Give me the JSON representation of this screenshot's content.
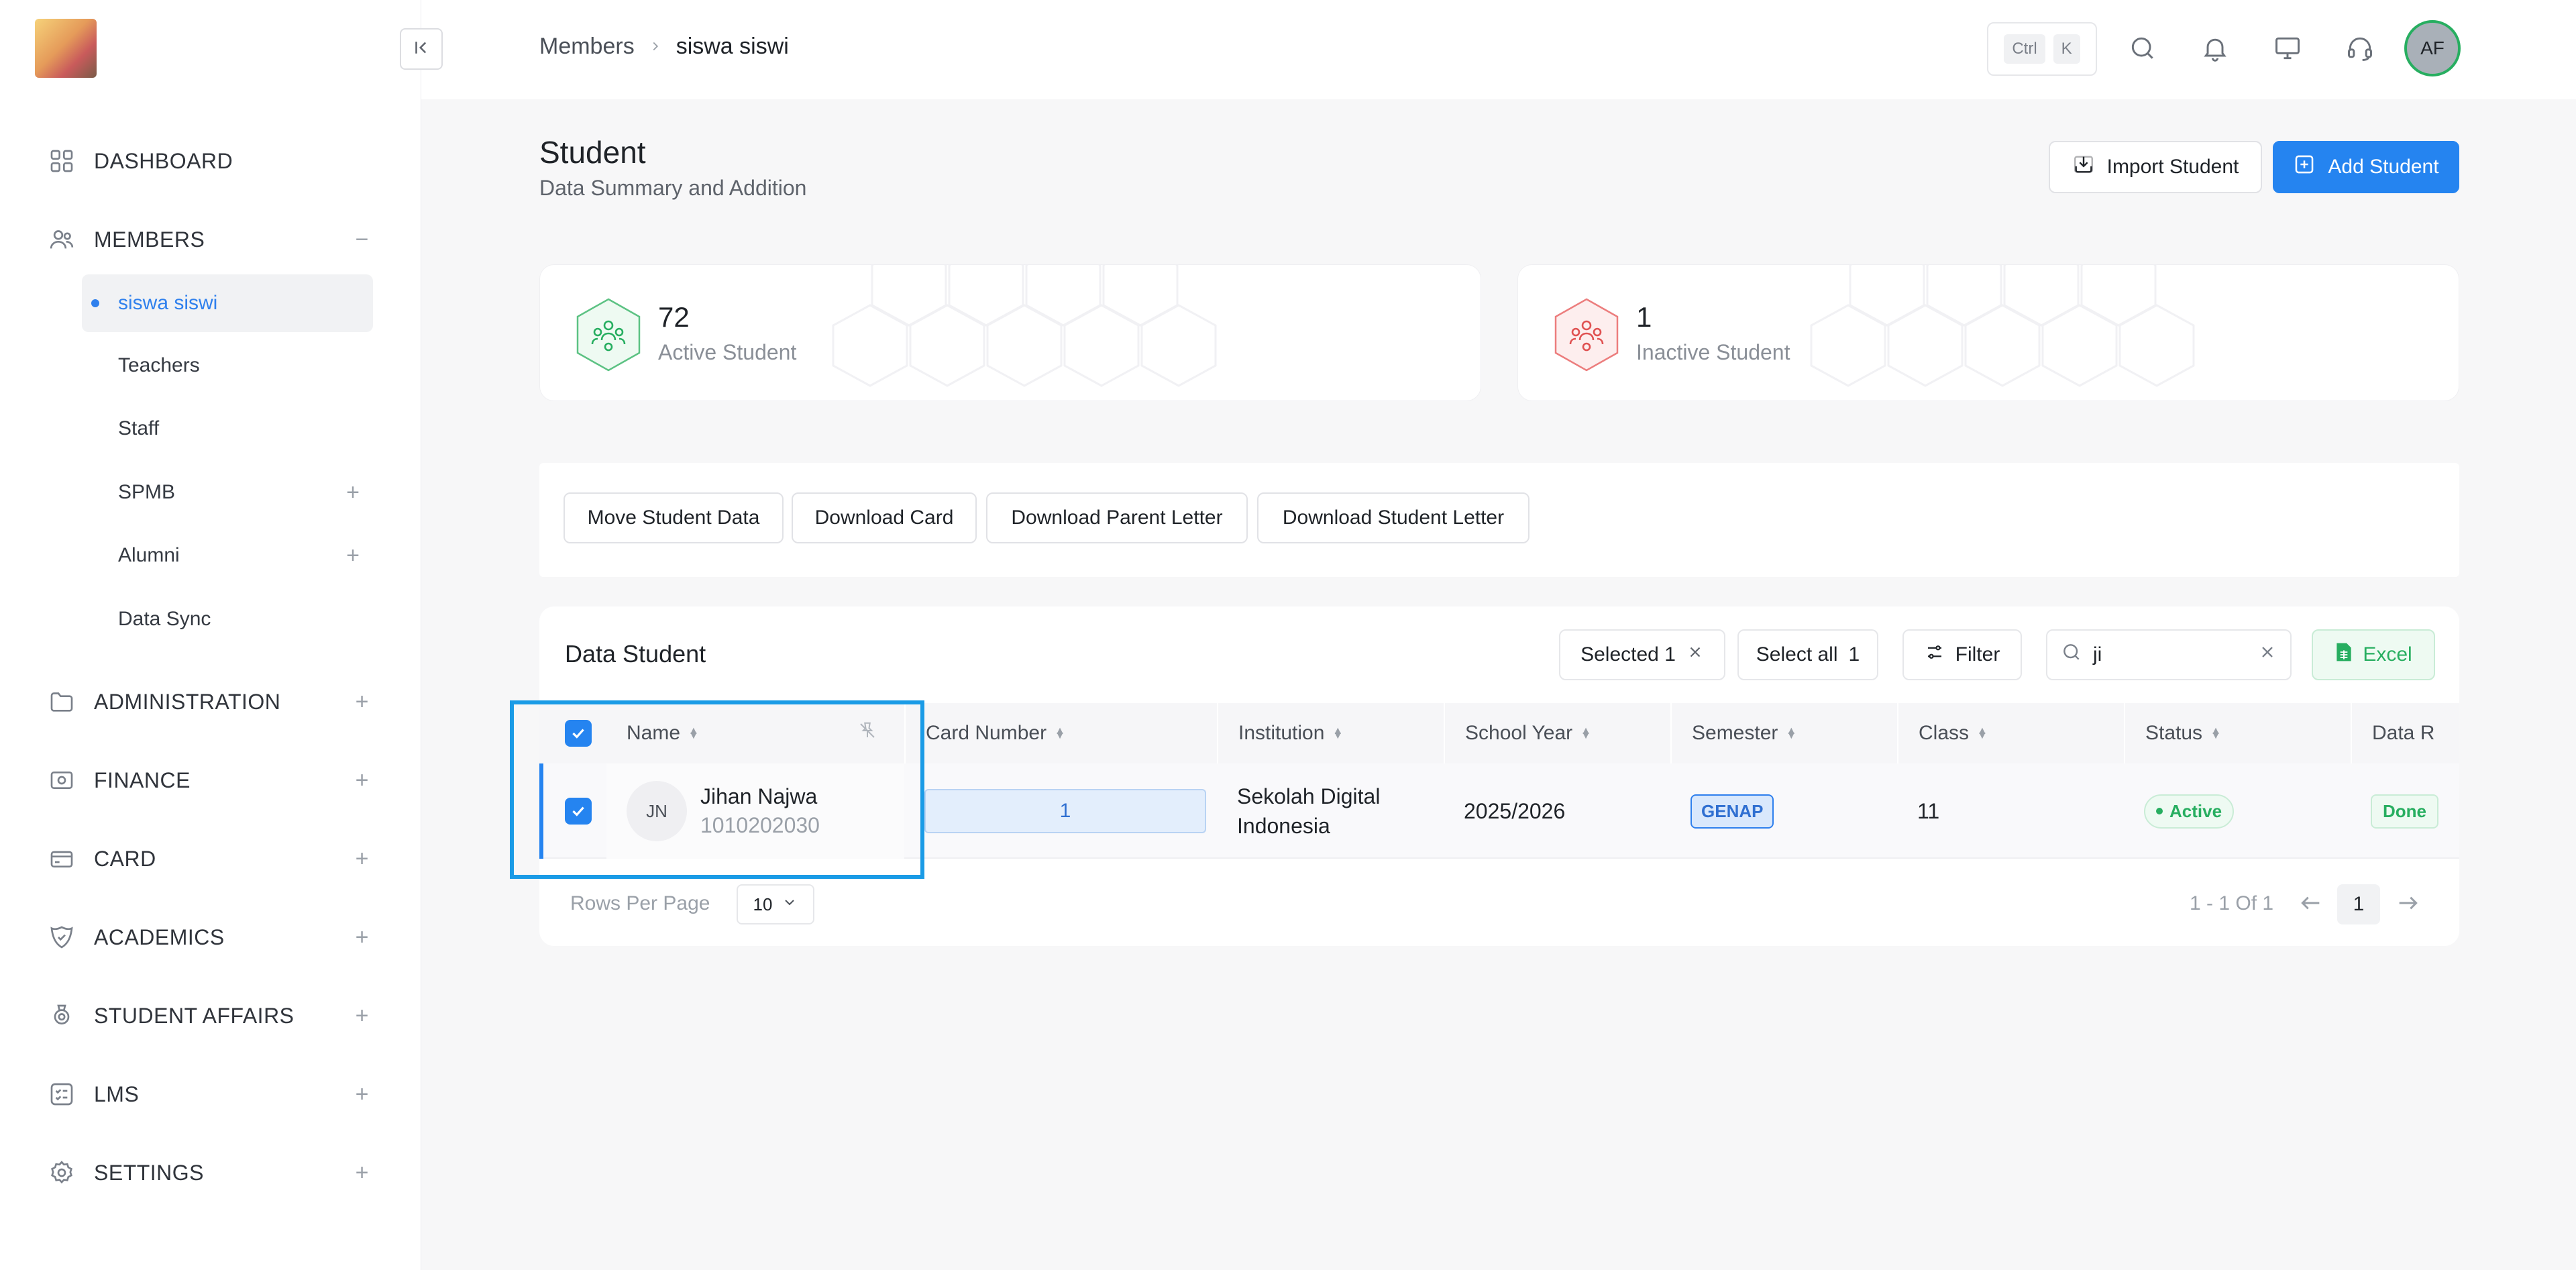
{
  "sidebar": {
    "items": [
      {
        "label": "DASHBOARD",
        "icon": "grid-icon",
        "sign": ""
      },
      {
        "label": "MEMBERS",
        "icon": "users-icon",
        "sign": "−"
      },
      {
        "label": "ADMINISTRATION",
        "icon": "folder-icon",
        "sign": "+"
      },
      {
        "label": "FINANCE",
        "icon": "money-icon",
        "sign": "+"
      },
      {
        "label": "CARD",
        "icon": "card-icon",
        "sign": "+"
      },
      {
        "label": "ACADEMICS",
        "icon": "academics-icon",
        "sign": "+"
      },
      {
        "label": "STUDENT AFFAIRS",
        "icon": "award-icon",
        "sign": "+"
      },
      {
        "label": "LMS",
        "icon": "checklist-icon",
        "sign": "+"
      },
      {
        "label": "SETTINGS",
        "icon": "gear-icon",
        "sign": "+"
      }
    ],
    "members_sub": [
      {
        "label": "siswa siswi",
        "sign": ""
      },
      {
        "label": "Teachers",
        "sign": ""
      },
      {
        "label": "Staff",
        "sign": ""
      },
      {
        "label": "SPMB",
        "sign": "+"
      },
      {
        "label": "Alumni",
        "sign": "+"
      },
      {
        "label": "Data Sync",
        "sign": ""
      }
    ]
  },
  "header": {
    "breadcrumb": [
      "Members",
      "siswa siswi"
    ],
    "shortcut": [
      "Ctrl",
      "K"
    ],
    "avatar_initials": "AF"
  },
  "page": {
    "title": "Student",
    "subtitle": "Data Summary and Addition",
    "import_label": "Import Student",
    "add_label": "Add Student"
  },
  "stats": {
    "active": {
      "value": "72",
      "label": "Active Student"
    },
    "inactive": {
      "value": "1",
      "label": "Inactive Student"
    }
  },
  "actions": [
    "Move Student Data",
    "Download Card",
    "Download Parent Letter",
    "Download Student Letter"
  ],
  "table": {
    "title": "Data Student",
    "selected_label": "Selected 1",
    "select_all_label": "Select all",
    "select_all_count": "1",
    "filter_label": "Filter",
    "search_value": "ji",
    "excel_label": "Excel",
    "columns": [
      "Name",
      "Card Number",
      "Institution",
      "School Year",
      "Semester",
      "Class",
      "Status",
      "Data R"
    ],
    "rows": [
      {
        "initials": "JN",
        "name": "Jihan Najwa",
        "nis": "1010202030",
        "card_number": "1",
        "institution_1": "Sekolah Digital",
        "institution_2": "Indonesia",
        "school_year": "2025/2026",
        "semester": "GENAP",
        "class": "11",
        "status": "Active",
        "data": "Done"
      }
    ],
    "rows_per_page_label": "Rows Per Page",
    "rows_per_page": "10",
    "range": "1 - 1 Of 1",
    "page": "1"
  },
  "colors": {
    "primary": "#2584f0",
    "success": "#27ae60",
    "danger": "#e05252",
    "highlight": "#1a9be6"
  }
}
